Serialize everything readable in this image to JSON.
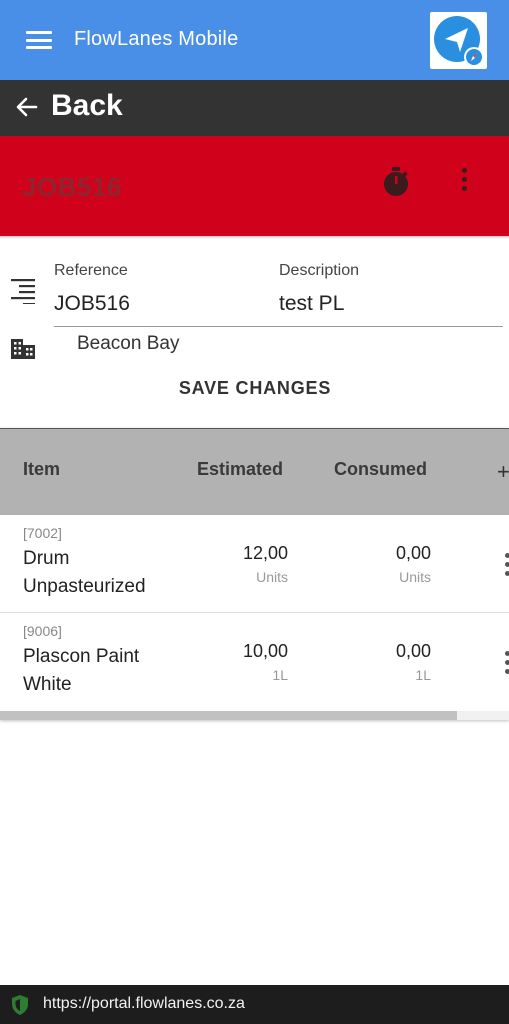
{
  "app": {
    "title": "FlowLanes Mobile",
    "menu_icon": "hamburger-menu-icon",
    "logo_icon": "navigation-compass-logo",
    "accent": "#4a8fe7"
  },
  "back": {
    "label": "Back",
    "icon": "arrow-left-icon"
  },
  "job": {
    "title": "JOB516",
    "bar_color": "#d0021b",
    "timer_icon": "stopwatch-icon",
    "more_icon": "more-vertical-icon"
  },
  "form": {
    "reference_label": "Reference",
    "reference_value": "JOB516",
    "description_label": "Description",
    "description_value": "test PL",
    "location": "Beacon Bay",
    "save_label": "SAVE CHANGES"
  },
  "table": {
    "headers": [
      "Item",
      "Estimated",
      "Consumed"
    ],
    "add_column_glyph": "+",
    "rows": [
      {
        "code": "[7002]",
        "name": "Drum Unpasteurized",
        "estimated": "12,00",
        "estimated_unit": "Units",
        "consumed": "0,00",
        "consumed_unit": "Units"
      },
      {
        "code": "[9006]",
        "name": "Plascon Paint White",
        "estimated": "10,00",
        "estimated_unit": "1L",
        "consumed": "0,00",
        "consumed_unit": "1L"
      }
    ]
  },
  "browser": {
    "url": "https://portal.flowlanes.co.za",
    "secure_color": "#2e7d32"
  }
}
